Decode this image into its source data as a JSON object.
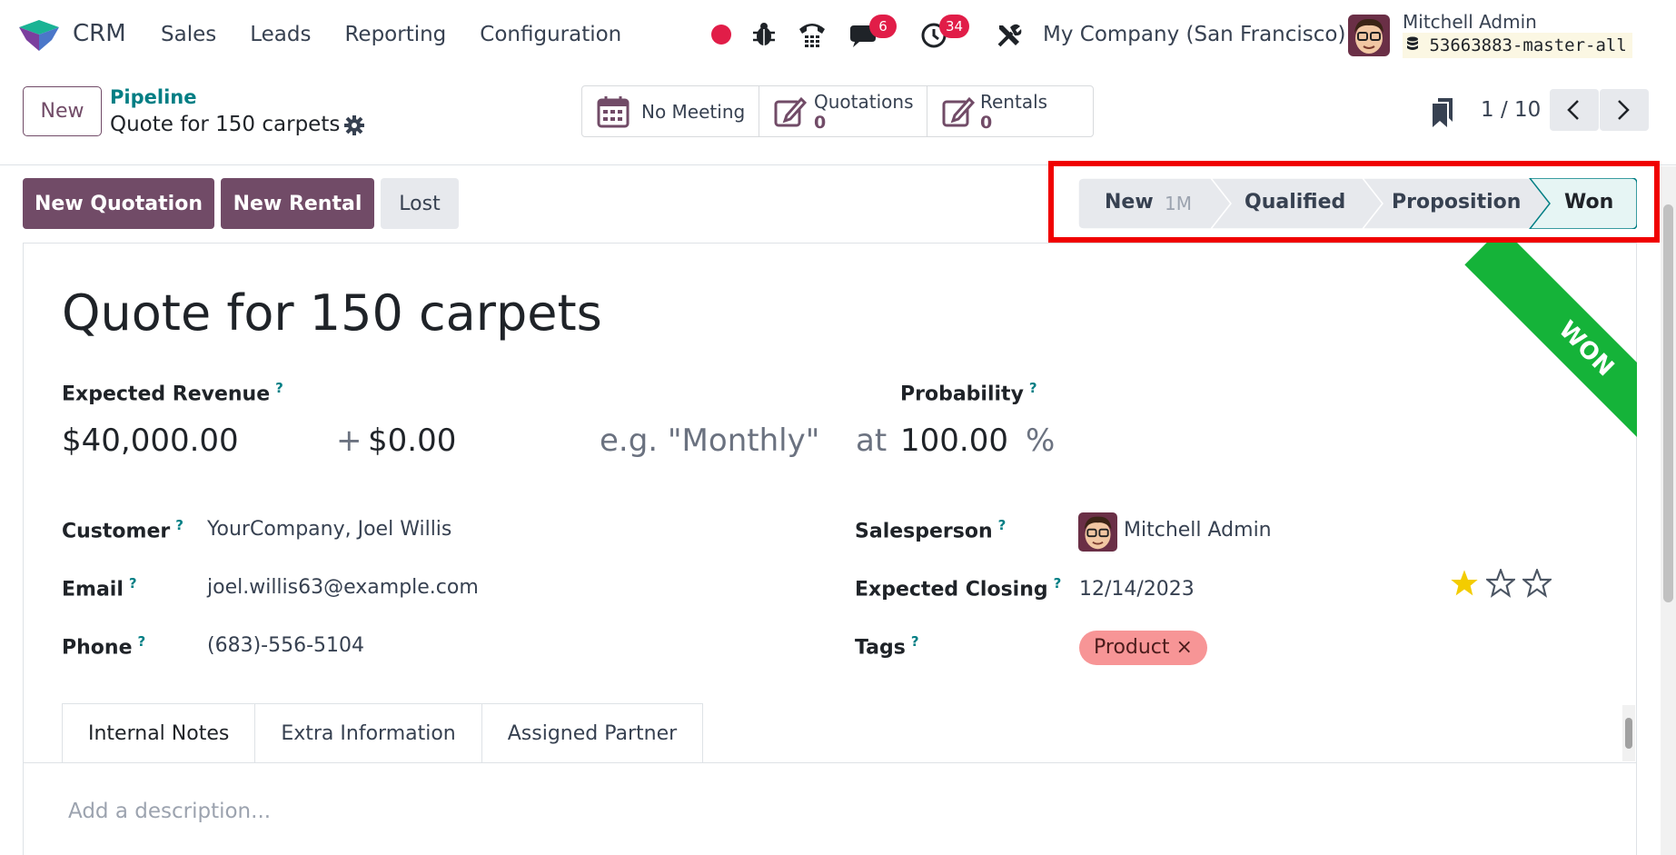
{
  "nav": {
    "app_name": "CRM",
    "menu": [
      "Sales",
      "Leads",
      "Reporting",
      "Configuration"
    ],
    "messages_count": "6",
    "activities_count": "34",
    "company": "My Company (San Francisco)",
    "user_name": "Mitchell Admin",
    "database": "53663883-master-all"
  },
  "control": {
    "new_label": "New",
    "breadcrumb": "Pipeline",
    "record_title": "Quote for 150 carpets",
    "smart_buttons": {
      "meeting": "No Meeting",
      "quotations_label": "Quotations",
      "quotations_count": "0",
      "rentals_label": "Rentals",
      "rentals_count": "0"
    },
    "pager": "1 / 10"
  },
  "actions": {
    "new_quotation": "New Quotation",
    "new_rental": "New Rental",
    "lost": "Lost"
  },
  "statusbar": {
    "stages": [
      "New",
      "Qualified",
      "Proposition",
      "Won"
    ],
    "new_duration": "1M",
    "active_stage": "Won",
    "highlight_color": "#f00000"
  },
  "ribbon": "WON",
  "form": {
    "lead_name": "Quote for 150 carpets",
    "expected_revenue_label": "Expected Revenue",
    "expected_revenue": "$40,000.00",
    "plus": "+",
    "recurring_revenue": "$0.00",
    "recurring_plan_placeholder": "e.g. \"Monthly\"",
    "at": "at",
    "probability_label": "Probability",
    "probability": "100.00",
    "percent": "%",
    "customer_label": "Customer",
    "customer": "YourCompany, Joel Willis",
    "email_label": "Email",
    "email": "joel.willis63@example.com",
    "phone_label": "Phone",
    "phone": "(683)-556-5104",
    "salesperson_label": "Salesperson",
    "salesperson": "Mitchell Admin",
    "expected_closing_label": "Expected Closing",
    "expected_closing": "12/14/2023",
    "priority_stars": 1,
    "priority_max": 3,
    "tags_label": "Tags",
    "tag": "Product",
    "tag_remove": "×",
    "help_mark": "?"
  },
  "tabs": [
    "Internal Notes",
    "Extra Information",
    "Assigned Partner"
  ],
  "notes_placeholder": "Add a description...",
  "colors": {
    "brand": "#714b67",
    "link": "#017e84",
    "ribbon": "#15b339",
    "badge": "#e11d48",
    "tag": "#f79596",
    "star": "#f3cc00"
  }
}
